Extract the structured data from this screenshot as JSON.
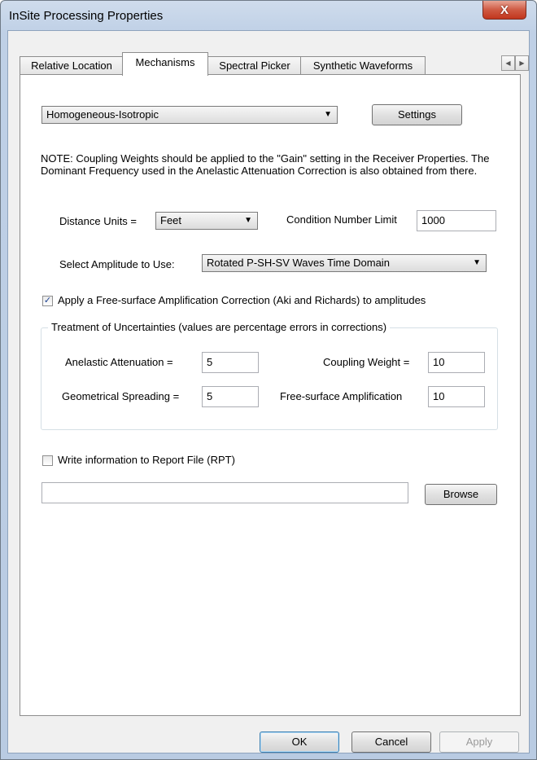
{
  "window": {
    "title": "InSite Processing Properties",
    "close_glyph": "X"
  },
  "tabs": [
    {
      "label": "Relative Location",
      "active": false
    },
    {
      "label": "Mechanisms",
      "active": true
    },
    {
      "label": "Spectral Picker",
      "active": false
    },
    {
      "label": "Synthetic Waveforms",
      "active": false
    }
  ],
  "tab_scroll": {
    "left": "◀",
    "right": "▶"
  },
  "model": {
    "selected": "Homogeneous-Isotropic",
    "settings_label": "Settings"
  },
  "note": "NOTE: Coupling Weights should be applied to the \"Gain\" setting in the Receiver Properties. The Dominant Frequency used in the Anelastic Attenuation Correction is also obtained from there.",
  "distance_units": {
    "label": "Distance Units =",
    "selected": "Feet"
  },
  "condition_number": {
    "label": "Condition Number Limit",
    "value": "1000"
  },
  "amplitude": {
    "label": "Select Amplitude to Use:",
    "selected": "Rotated P-SH-SV Waves Time Domain"
  },
  "free_surface_check": {
    "label": "Apply a Free-surface Amplification Correction (Aki and Richards) to amplitudes",
    "checked": true
  },
  "uncertainties": {
    "title": "Treatment of Uncertainties (values are percentage errors in corrections)",
    "anelastic": {
      "label": "Anelastic Attenuation =",
      "value": "5"
    },
    "coupling": {
      "label": "Coupling Weight =",
      "value": "10"
    },
    "geometrical": {
      "label": "Geometrical Spreading =",
      "value": "5"
    },
    "free_surface": {
      "label": "Free-surface Amplification",
      "value": "10"
    }
  },
  "report": {
    "label": "Write information to Report File (RPT)",
    "checked": false,
    "path": "",
    "browse_label": "Browse"
  },
  "footer": {
    "ok": "OK",
    "cancel": "Cancel",
    "apply": "Apply"
  },
  "icons": {
    "dropdown": "▼",
    "check": "✓"
  }
}
